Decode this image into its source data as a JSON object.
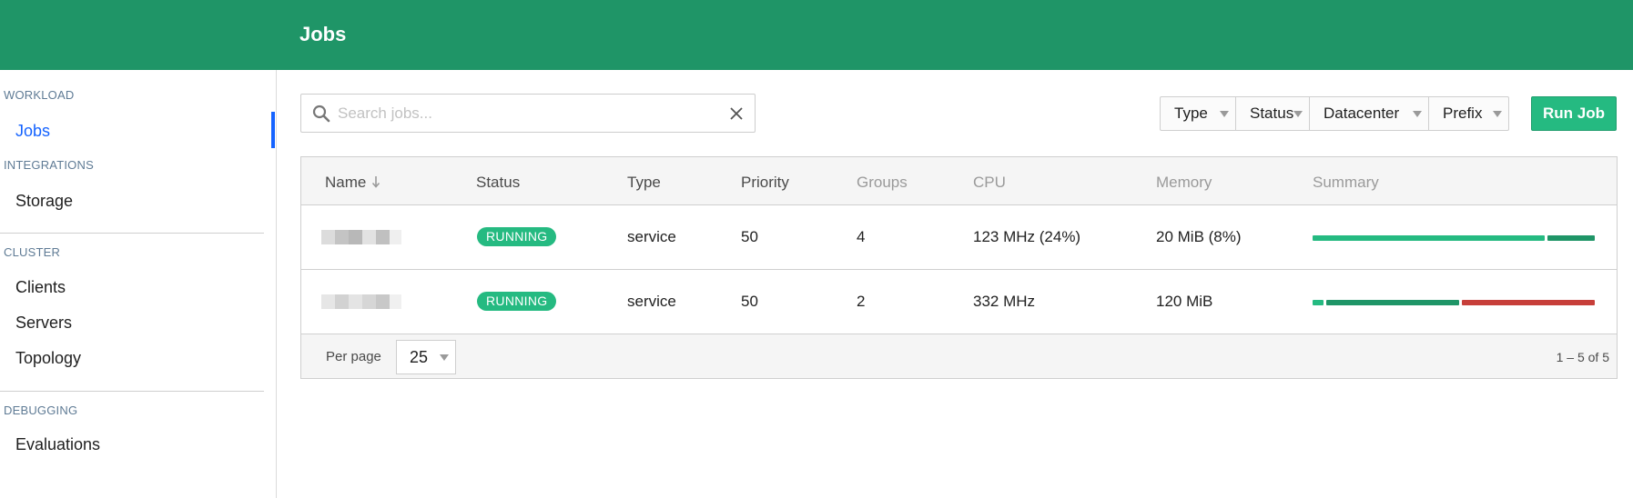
{
  "header": {
    "title": "Jobs"
  },
  "sidebar": {
    "sections": [
      {
        "heading": "WORKLOAD",
        "items": [
          "Jobs"
        ]
      },
      {
        "heading": "INTEGRATIONS",
        "items": [
          "Storage"
        ]
      },
      {
        "heading": "CLUSTER",
        "items": [
          "Clients",
          "Servers",
          "Topology"
        ]
      },
      {
        "heading": "DEBUGGING",
        "items": [
          "Evaluations"
        ]
      }
    ],
    "active_item": "Jobs"
  },
  "search": {
    "placeholder": "Search jobs...",
    "value": ""
  },
  "filters": [
    "Type",
    "Status",
    "Datacenter",
    "Prefix"
  ],
  "run_job_label": "Run Job",
  "table": {
    "columns": [
      "Name",
      "Status",
      "Type",
      "Priority",
      "Groups",
      "CPU",
      "Memory",
      "Summary"
    ],
    "sorted_by": "Name",
    "rows": [
      {
        "name": "",
        "status": "RUNNING",
        "type": "service",
        "priority": "50",
        "groups": "4",
        "cpu": "123 MHz (24%)",
        "memory": "20 MiB (8%)",
        "summary": [
          {
            "state": "running",
            "fraction": 0.83,
            "color": "#25ba81"
          },
          {
            "state": "complete",
            "fraction": 0.17,
            "color": "#1f9567"
          }
        ]
      },
      {
        "name": "",
        "status": "RUNNING",
        "type": "service",
        "priority": "50",
        "groups": "2",
        "cpu": "332 MHz",
        "memory": "120 MiB",
        "summary": [
          {
            "state": "running",
            "fraction": 0.04,
            "color": "#25ba81"
          },
          {
            "state": "complete",
            "fraction": 0.48,
            "color": "#1f9567"
          },
          {
            "state": "failed",
            "fraction": 0.48,
            "color": "#c73f3a"
          }
        ]
      }
    ]
  },
  "footer": {
    "per_page_label": "Per page",
    "per_page_value": "25",
    "pagination": "1 – 5 of 5"
  },
  "colors": {
    "header_bg": "#1f9567",
    "primary": "#25ba81",
    "link_active": "#1563ff",
    "danger": "#c73f3a"
  }
}
